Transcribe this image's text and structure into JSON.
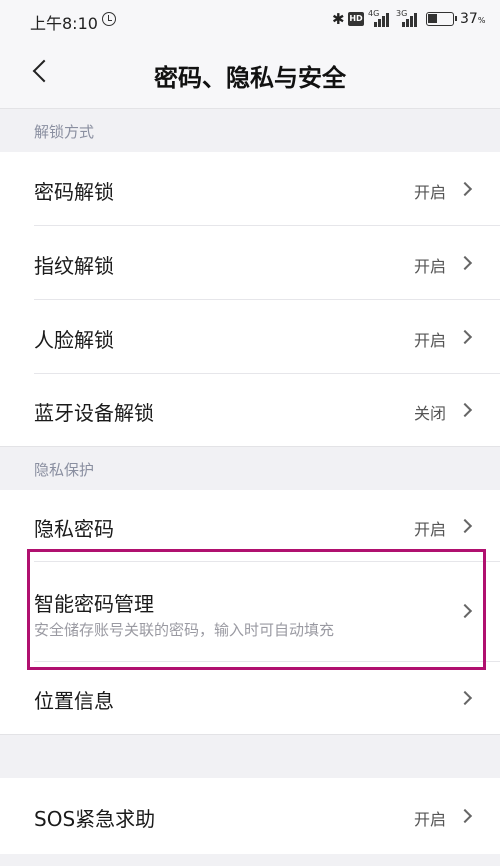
{
  "status_bar": {
    "time": "上午8:10",
    "hd": "HD",
    "sim1": "4G",
    "sim2": "3G",
    "battery": "37",
    "battery_unit": "%",
    "icons": [
      "alarm-icon",
      "bluetooth-icon",
      "signal-icon",
      "battery-icon"
    ]
  },
  "header": {
    "title": "密码、隐私与安全",
    "back_icon": "back-arrow-icon"
  },
  "sections": {
    "unlock": {
      "header": "解锁方式",
      "items": [
        {
          "label": "密码解锁",
          "value": "开启"
        },
        {
          "label": "指纹解锁",
          "value": "开启"
        },
        {
          "label": "人脸解锁",
          "value": "开启"
        },
        {
          "label": "蓝牙设备解锁",
          "value": "关闭"
        }
      ]
    },
    "privacy": {
      "header": "隐私保护",
      "items": [
        {
          "label": "隐私密码",
          "value": "开启"
        },
        {
          "label": "智能密码管理",
          "subtitle": "安全储存账号关联的密码，输入时可自动填充"
        },
        {
          "label": "位置信息"
        }
      ]
    },
    "emergency": {
      "items": [
        {
          "label": "SOS紧急求助",
          "value": "开启"
        }
      ]
    }
  },
  "colors": {
    "highlight_border": "#b0106f",
    "section_bg": "#f1f1f4",
    "row_bg": "#ffffff",
    "section_text": "#8a8fa0"
  }
}
